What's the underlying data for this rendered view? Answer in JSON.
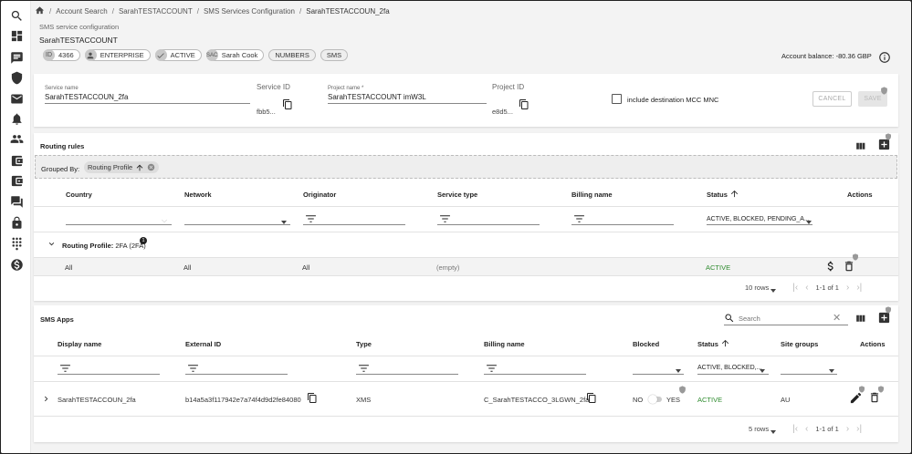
{
  "breadcrumb": [
    "Account Search",
    "SarahTESTACCOUNT",
    "SMS Services Configuration",
    "SarahTESTACCOUN_2fa"
  ],
  "header": {
    "subtitle": "SMS service configuration",
    "account": "SarahTESTACCOUNT",
    "chips": {
      "id_avatar": "ID",
      "id_value": "4366",
      "enterprise": "ENTERPRISE",
      "active": "ACTIVE",
      "sac_avatar": "SAC",
      "owner": "Sarah Cook",
      "numbers": "NUMBERS",
      "sms": "SMS"
    },
    "balance": "Account balance: -80.36 GBP"
  },
  "form": {
    "service_name_label": "Service name",
    "service_name_value": "SarahTESTACCOUN_2fa",
    "service_id_label": "Service ID",
    "service_id_value": "fbb5...",
    "project_name_label": "Project name *",
    "project_name_value": "SarahTESTACCOUNT imW3L",
    "project_id_label": "Project ID",
    "project_id_value": "e8d5...",
    "include_mcc_label": "include destination MCC MNC",
    "cancel_label": "CANCEL",
    "save_label": "SAVE"
  },
  "routing": {
    "title": "Routing rules",
    "grouped_by_label": "Grouped By:",
    "group_chip": "Routing Profile",
    "columns": [
      "Country",
      "Network",
      "Originator",
      "Service type",
      "Billing name",
      "Status",
      "Actions"
    ],
    "status_filter": "ACTIVE, BLOCKED, PENDING_A...",
    "group_label": "Routing Profile:",
    "group_value": "2FA (2FA)",
    "group_count": "1",
    "row": {
      "country": "All",
      "network": "All",
      "originator": "All",
      "service_type": "(empty)",
      "status": "ACTIVE"
    },
    "pager_rows": "10 rows",
    "pager_range": "1-1 of 1"
  },
  "apps": {
    "title": "SMS Apps",
    "search_placeholder": "Search",
    "columns": [
      "Display name",
      "External ID",
      "Type",
      "Billing name",
      "Blocked",
      "Status",
      "Site groups",
      "Actions"
    ],
    "status_filter": "ACTIVE, BLOCKED,...",
    "row": {
      "display_name": "SarahTESTACCOUN_2fa",
      "external_id": "b14a5a3f117942e7a74f4d9d2fe84080",
      "type": "XMS",
      "billing_name": "C_SarahTESTACCO_3LGWN_2fa",
      "blocked_no": "NO",
      "blocked_yes": "YES",
      "status": "ACTIVE",
      "site_groups": "AU"
    },
    "pager_rows": "5 rows",
    "pager_range": "1-1 of 1"
  },
  "colors": {
    "accent": "#2e8b2e",
    "background": "#f3f3f3"
  }
}
